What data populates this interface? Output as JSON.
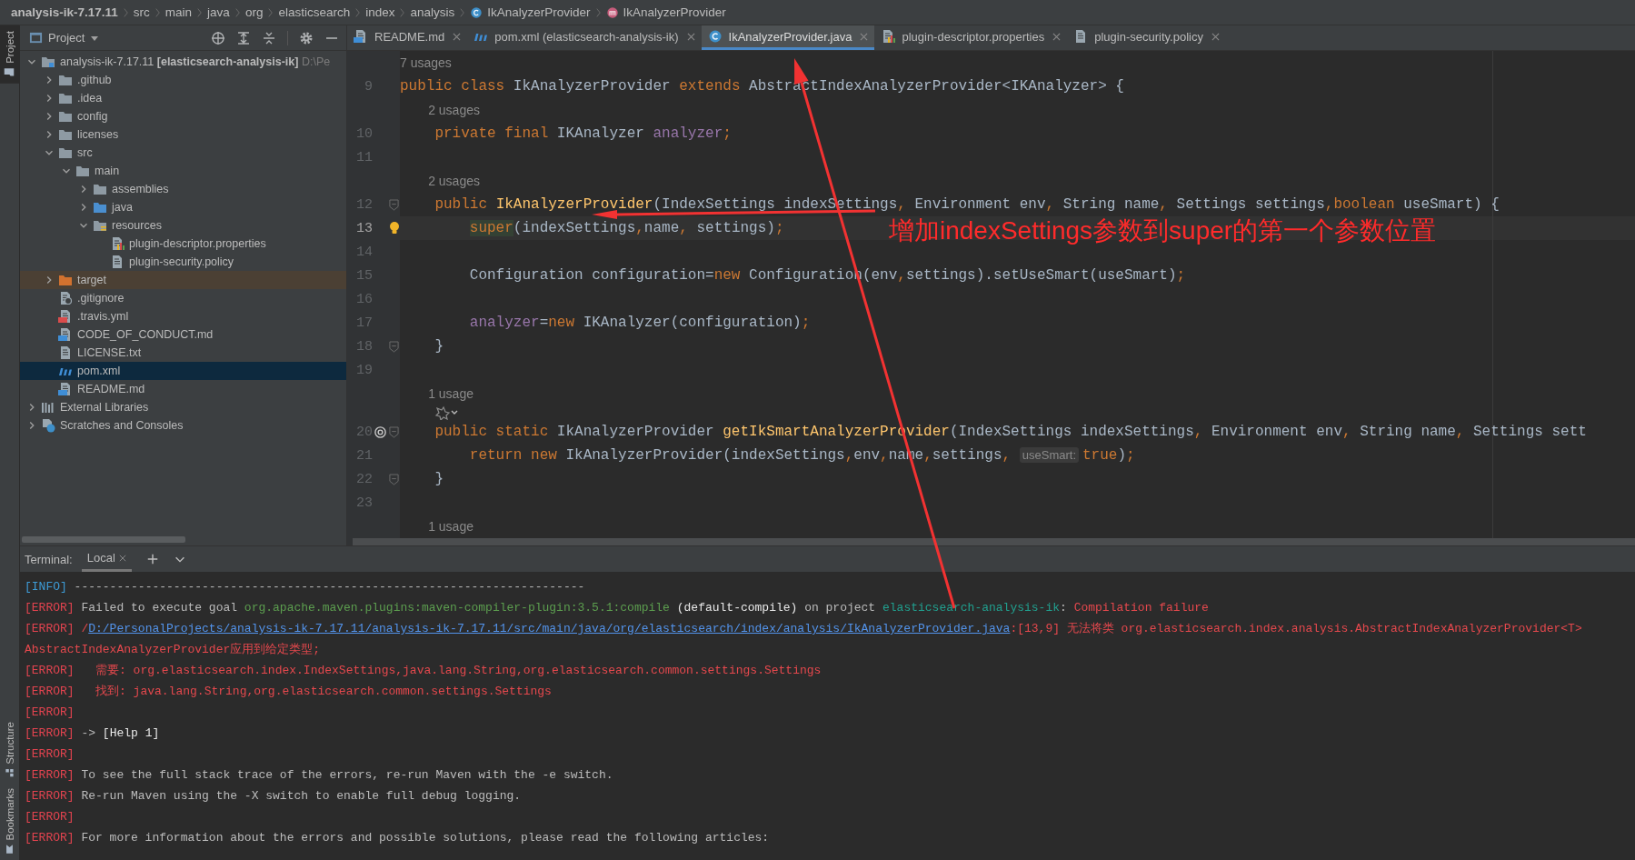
{
  "breadcrumb": [
    {
      "label": "analysis-ik-7.17.11",
      "kind": "project"
    },
    {
      "label": "src",
      "kind": "folder"
    },
    {
      "label": "main",
      "kind": "folder"
    },
    {
      "label": "java",
      "kind": "folder"
    },
    {
      "label": "org",
      "kind": "folder"
    },
    {
      "label": "elasticsearch",
      "kind": "folder"
    },
    {
      "label": "index",
      "kind": "folder"
    },
    {
      "label": "analysis",
      "kind": "folder"
    },
    {
      "label": "IkAnalyzerProvider",
      "kind": "class"
    },
    {
      "label": "IkAnalyzerProvider",
      "kind": "method"
    }
  ],
  "side_tools": {
    "top": [
      {
        "label": "Project",
        "selected": true
      }
    ],
    "bottom": [
      {
        "label": "Structure",
        "selected": false
      },
      {
        "label": "Bookmarks",
        "selected": false
      }
    ]
  },
  "project_panel": {
    "title": "Project",
    "tree": [
      {
        "label": "analysis-ik-7.17.11",
        "module": "[elasticsearch-analysis-ik]",
        "path": "D:\\Pe",
        "kind": "module",
        "expanded": true,
        "selected": false,
        "children": [
          {
            "label": ".github",
            "kind": "folder",
            "expanded": false,
            "selected": false
          },
          {
            "label": ".idea",
            "kind": "folder",
            "expanded": false,
            "selected": false
          },
          {
            "label": "config",
            "kind": "folder",
            "expanded": false,
            "selected": false
          },
          {
            "label": "licenses",
            "kind": "folder",
            "expanded": false,
            "selected": false
          },
          {
            "label": "src",
            "kind": "folder",
            "expanded": true,
            "selected": false,
            "children": [
              {
                "label": "main",
                "kind": "folder",
                "expanded": true,
                "selected": false,
                "children": [
                  {
                    "label": "assemblies",
                    "kind": "folder",
                    "expanded": false,
                    "selected": false
                  },
                  {
                    "label": "java",
                    "kind": "java-folder",
                    "expanded": false,
                    "selected": false
                  },
                  {
                    "label": "resources",
                    "kind": "resources-folder",
                    "expanded": true,
                    "selected": false,
                    "children": [
                      {
                        "label": "plugin-descriptor.properties",
                        "kind": "properties",
                        "selected": false
                      },
                      {
                        "label": "plugin-security.policy",
                        "kind": "policy",
                        "selected": false
                      }
                    ]
                  }
                ]
              }
            ]
          },
          {
            "label": "target",
            "kind": "excluded-folder",
            "expanded": false,
            "selected": false
          },
          {
            "label": ".gitignore",
            "kind": "gitignore",
            "selected": false
          },
          {
            "label": ".travis.yml",
            "kind": "yml",
            "selected": false
          },
          {
            "label": "CODE_OF_CONDUCT.md",
            "kind": "md",
            "selected": false
          },
          {
            "label": "LICENSE.txt",
            "kind": "txt",
            "selected": false
          },
          {
            "label": "pom.xml",
            "kind": "pom",
            "selected": true
          },
          {
            "label": "README.md",
            "kind": "md",
            "selected": false
          }
        ]
      },
      {
        "label": "External Libraries",
        "kind": "libraries",
        "expanded": false,
        "selected": false
      },
      {
        "label": "Scratches and Consoles",
        "kind": "scratches",
        "expanded": false,
        "selected": false
      }
    ]
  },
  "tabs": [
    {
      "label": "README.md",
      "kind": "md",
      "selected": false
    },
    {
      "label": "pom.xml (elasticsearch-analysis-ik)",
      "kind": "pom",
      "selected": false
    },
    {
      "label": "IkAnalyzerProvider.java",
      "kind": "java",
      "selected": true
    },
    {
      "label": "plugin-descriptor.properties",
      "kind": "properties",
      "selected": false
    },
    {
      "label": "plugin-security.policy",
      "kind": "policy",
      "selected": false
    }
  ],
  "editor": {
    "lines": [
      {
        "kind": "hint",
        "text": "7 usages"
      },
      {
        "kind": "code",
        "number": "9",
        "current": false,
        "fold": false,
        "bulb": false,
        "override": false,
        "tokens": [
          {
            "text": "public class ",
            "kind": "keyword"
          },
          {
            "text": "IkAnalyzerProvider ",
            "kind": "plain"
          },
          {
            "text": "extends ",
            "kind": "keyword"
          },
          {
            "text": "AbstractIndexAnalyzerProvider<IKAnalyzer> {",
            "kind": "plain"
          }
        ]
      },
      {
        "kind": "hint",
        "text": "    2 usages"
      },
      {
        "kind": "code",
        "number": "10",
        "current": false,
        "fold": false,
        "bulb": false,
        "override": false,
        "tokens": [
          {
            "text": "    private final ",
            "kind": "keyword"
          },
          {
            "text": "IKAnalyzer ",
            "kind": "plain"
          },
          {
            "text": "analyzer",
            "kind": "field"
          },
          {
            "text": ";",
            "kind": "punct"
          }
        ]
      },
      {
        "kind": "code",
        "number": "11",
        "current": false,
        "fold": false,
        "bulb": false,
        "override": false
      },
      {
        "kind": "hint",
        "text": "    2 usages"
      },
      {
        "kind": "code",
        "number": "12",
        "current": false,
        "fold": true,
        "bulb": false,
        "override": false,
        "tokens": [
          {
            "text": "    public ",
            "kind": "keyword"
          },
          {
            "text": "IkAnalyzerProvider",
            "kind": "method"
          },
          {
            "text": "(IndexSettings indexSettings",
            "kind": "plain"
          },
          {
            "text": ", ",
            "kind": "punct"
          },
          {
            "text": "Environment env",
            "kind": "plain"
          },
          {
            "text": ", ",
            "kind": "punct"
          },
          {
            "text": "String name",
            "kind": "plain"
          },
          {
            "text": ", ",
            "kind": "punct"
          },
          {
            "text": "Settings settings",
            "kind": "plain"
          },
          {
            "text": ",",
            "kind": "punct"
          },
          {
            "text": "boolean ",
            "kind": "keyword"
          },
          {
            "text": "useSmart) {",
            "kind": "plain"
          }
        ]
      },
      {
        "kind": "code",
        "number": "13",
        "current": true,
        "fold": false,
        "bulb": true,
        "override": false,
        "tokens": [
          {
            "text": "        super",
            "kind": "keyword-highlight"
          },
          {
            "text": "(indexSettings",
            "kind": "plain"
          },
          {
            "text": ",",
            "kind": "punct"
          },
          {
            "text": "name",
            "kind": "plain"
          },
          {
            "text": ", ",
            "kind": "punct"
          },
          {
            "text": "settings)",
            "kind": "plain"
          },
          {
            "text": ";",
            "kind": "punct"
          }
        ]
      },
      {
        "kind": "code",
        "number": "14",
        "current": false,
        "fold": false,
        "bulb": false,
        "override": false
      },
      {
        "kind": "code",
        "number": "15",
        "current": false,
        "fold": false,
        "bulb": false,
        "override": false,
        "tokens": [
          {
            "text": "        Configuration configuration=",
            "kind": "plain"
          },
          {
            "text": "new ",
            "kind": "keyword"
          },
          {
            "text": "Configuration(env",
            "kind": "plain"
          },
          {
            "text": ",",
            "kind": "punct"
          },
          {
            "text": "settings).setUseSmart(useSmart)",
            "kind": "plain"
          },
          {
            "text": ";",
            "kind": "punct"
          }
        ]
      },
      {
        "kind": "code",
        "number": "16",
        "current": false,
        "fold": false,
        "bulb": false,
        "override": false
      },
      {
        "kind": "code",
        "number": "17",
        "current": false,
        "fold": false,
        "bulb": false,
        "override": false,
        "tokens": [
          {
            "text": "        analyzer",
            "kind": "field"
          },
          {
            "text": "=",
            "kind": "plain"
          },
          {
            "text": "new ",
            "kind": "keyword"
          },
          {
            "text": "IKAnalyzer(configuration)",
            "kind": "plain"
          },
          {
            "text": ";",
            "kind": "punct"
          }
        ]
      },
      {
        "kind": "code",
        "number": "18",
        "current": false,
        "fold": true,
        "bulb": false,
        "override": false,
        "tokens": [
          {
            "text": "    }",
            "kind": "plain"
          }
        ]
      },
      {
        "kind": "code",
        "number": "19",
        "current": false,
        "fold": false,
        "bulb": false,
        "override": false
      },
      {
        "kind": "hint",
        "text": "    1 usage"
      },
      {
        "kind": "icons"
      },
      {
        "kind": "code",
        "number": "20",
        "current": false,
        "fold": true,
        "bulb": false,
        "override": true,
        "tokens": [
          {
            "text": "    public static ",
            "kind": "keyword"
          },
          {
            "text": "IkAnalyzerProvider ",
            "kind": "plain"
          },
          {
            "text": "getIkSmartAnalyzerProvider",
            "kind": "method"
          },
          {
            "text": "(IndexSettings indexSettings",
            "kind": "plain"
          },
          {
            "text": ", ",
            "kind": "punct"
          },
          {
            "text": "Environment env",
            "kind": "plain"
          },
          {
            "text": ", ",
            "kind": "punct"
          },
          {
            "text": "String name",
            "kind": "plain"
          },
          {
            "text": ", ",
            "kind": "punct"
          },
          {
            "text": "Settings sett",
            "kind": "plain"
          }
        ]
      },
      {
        "kind": "code",
        "number": "21",
        "current": false,
        "fold": false,
        "bulb": false,
        "override": false,
        "tokens": [
          {
            "text": "        return new ",
            "kind": "keyword"
          },
          {
            "text": "IkAnalyzerProvider(indexSettings",
            "kind": "plain"
          },
          {
            "text": ",",
            "kind": "punct"
          },
          {
            "text": "env",
            "kind": "plain"
          },
          {
            "text": ",",
            "kind": "punct"
          },
          {
            "text": "name",
            "kind": "plain"
          },
          {
            "text": ",",
            "kind": "punct"
          },
          {
            "text": "settings",
            "kind": "plain"
          },
          {
            "text": ", ",
            "kind": "punct"
          },
          {
            "text": "useSmart:",
            "kind": "inlay"
          },
          {
            "text": "true",
            "kind": "keyword"
          },
          {
            "text": ")",
            "kind": "plain"
          },
          {
            "text": ";",
            "kind": "punct"
          }
        ]
      },
      {
        "kind": "code",
        "number": "22",
        "current": false,
        "fold": true,
        "bulb": false,
        "override": false,
        "tokens": [
          {
            "text": "    }",
            "kind": "plain"
          }
        ]
      },
      {
        "kind": "code",
        "number": "23",
        "current": false,
        "fold": false,
        "bulb": false,
        "override": false
      },
      {
        "kind": "hint",
        "text": "    1 usage"
      }
    ]
  },
  "annotation": {
    "text": "增加indexSettings参数到super的第一个参数位置"
  },
  "terminal": {
    "title": "Terminal:",
    "tabs": [
      {
        "label": "Local",
        "selected": true
      }
    ],
    "lines": [
      [
        {
          "text": "[INFO]",
          "kind": "tag-info"
        },
        {
          "text": " ------------------------------------------------------------------------",
          "kind": "plain"
        }
      ],
      [
        {
          "text": "[ERROR]",
          "kind": "tag-error"
        },
        {
          "text": " Failed to execute goal ",
          "kind": "plain"
        },
        {
          "text": "org.apache.maven.plugins:maven-compiler-plugin:3.5.1:compile",
          "kind": "green"
        },
        {
          "text": " (default-compile)",
          "kind": "bright"
        },
        {
          "text": " on project ",
          "kind": "plain"
        },
        {
          "text": "elasticsearch-analysis-ik",
          "kind": "teal"
        },
        {
          "text": ": ",
          "kind": "plain"
        },
        {
          "text": "Compilation failure",
          "kind": "error"
        }
      ],
      [
        {
          "text": "[ERROR]",
          "kind": "tag-error"
        },
        {
          "text": " /",
          "kind": "error"
        },
        {
          "text": "D:/PersonalProjects/analysis-ik-7.17.11/analysis-ik-7.17.11/src/main/java/org/elasticsearch/index/analysis/IkAnalyzerProvider.java",
          "kind": "link"
        },
        {
          "text": ":[13,9] 无法将类 org.elasticsearch.index.analysis.AbstractIndexAnalyzerProvider<T>",
          "kind": "error"
        }
      ],
      [
        {
          "text": "AbstractIndexAnalyzerProvider应用到给定类型;",
          "kind": "error"
        }
      ],
      [
        {
          "text": "[ERROR]",
          "kind": "tag-error"
        },
        {
          "text": "   需要: org.elasticsearch.index.IndexSettings,java.lang.String,org.elasticsearch.common.settings.Settings",
          "kind": "error"
        }
      ],
      [
        {
          "text": "[ERROR]",
          "kind": "tag-error"
        },
        {
          "text": "   找到: java.lang.String,org.elasticsearch.common.settings.Settings",
          "kind": "error"
        }
      ],
      [
        {
          "text": "[ERROR]",
          "kind": "tag-error"
        }
      ],
      [
        {
          "text": "[ERROR]",
          "kind": "tag-error"
        },
        {
          "text": " -> ",
          "kind": "plain"
        },
        {
          "text": "[Help 1]",
          "kind": "bright"
        }
      ],
      [
        {
          "text": "[ERROR]",
          "kind": "tag-error"
        }
      ],
      [
        {
          "text": "[ERROR]",
          "kind": "tag-error"
        },
        {
          "text": " To see the full stack trace of the errors, re-run Maven with the -e switch.",
          "kind": "plain"
        }
      ],
      [
        {
          "text": "[ERROR]",
          "kind": "tag-error"
        },
        {
          "text": " Re-run Maven using the -X switch to enable full debug logging.",
          "kind": "plain"
        }
      ],
      [
        {
          "text": "[ERROR]",
          "kind": "tag-error"
        }
      ],
      [
        {
          "text": "[ERROR]",
          "kind": "tag-error"
        },
        {
          "text": " For more information about the errors and possible solutions, please read the following articles:",
          "kind": "plain"
        }
      ]
    ]
  }
}
